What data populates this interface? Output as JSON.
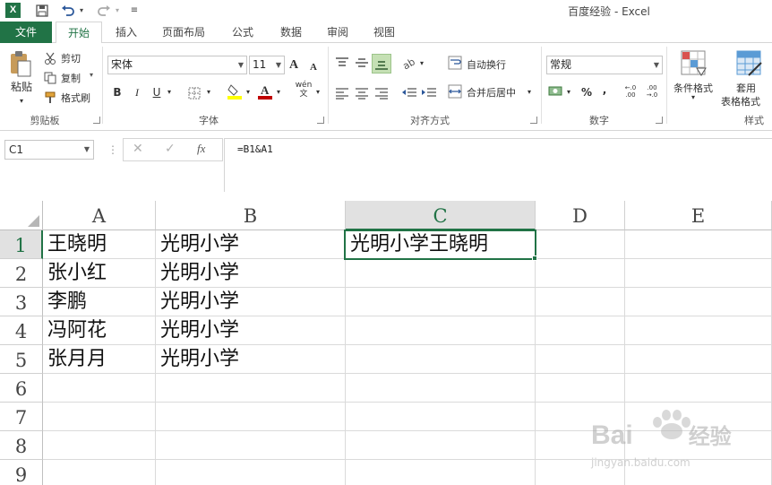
{
  "titlebar": {
    "app_icon": "X",
    "title": "百度经验 - Excel",
    "qat": {
      "save": "save-icon",
      "undo": "undo-icon",
      "redo": "redo-icon",
      "customize": "customize-icon"
    }
  },
  "tabs": {
    "file": "文件",
    "items": [
      "开始",
      "插入",
      "页面布局",
      "公式",
      "数据",
      "审阅",
      "视图"
    ],
    "active": "开始"
  },
  "ribbon": {
    "clipboard": {
      "paste": "粘贴",
      "cut": "剪切",
      "copy": "复制",
      "format_painter": "格式刷",
      "label": "剪贴板"
    },
    "font": {
      "name": "宋体",
      "size": "11",
      "grow": "A",
      "shrink": "A",
      "bold": "B",
      "italic": "I",
      "underline": "U",
      "label": "字体",
      "wen": "wén"
    },
    "alignment": {
      "wrap": "自动换行",
      "merge": "合并后居中",
      "label": "对齐方式"
    },
    "number": {
      "format": "常规",
      "percent": "%",
      "comma": ",",
      "inc_decimal": "←.0 .00",
      "dec_decimal": ".00 →.0",
      "label": "数字"
    },
    "styles": {
      "conditional": "条件格式",
      "table_format_1": "套用",
      "table_format_2": "表格格式",
      "label": "样式"
    },
    "colors": {
      "accent": "#217346",
      "highlight": "#ffff00",
      "font_color": "#c00000"
    }
  },
  "formula_bar": {
    "name_box": "C1",
    "cancel": "✕",
    "enter": "✓",
    "fx": "fx",
    "formula": "=B1&A1"
  },
  "sheet": {
    "columns": [
      "A",
      "B",
      "C",
      "D",
      "E"
    ],
    "rows": [
      "1",
      "2",
      "3",
      "4",
      "5",
      "6",
      "7",
      "8",
      "9"
    ],
    "selected_cell": "C1",
    "cells": {
      "A1": "王晓明",
      "B1": "光明小学",
      "C1": "光明小学王晓明",
      "A2": "张小红",
      "B2": "光明小学",
      "A3": "李鹏",
      "B3": "光明小学",
      "A4": "冯阿花",
      "B4": "光明小学",
      "A5": "张月月",
      "B5": "光明小学"
    }
  },
  "watermark": {
    "logo": "Bai",
    "logo_tail": "经验",
    "url": "jingyan.baidu.com"
  }
}
